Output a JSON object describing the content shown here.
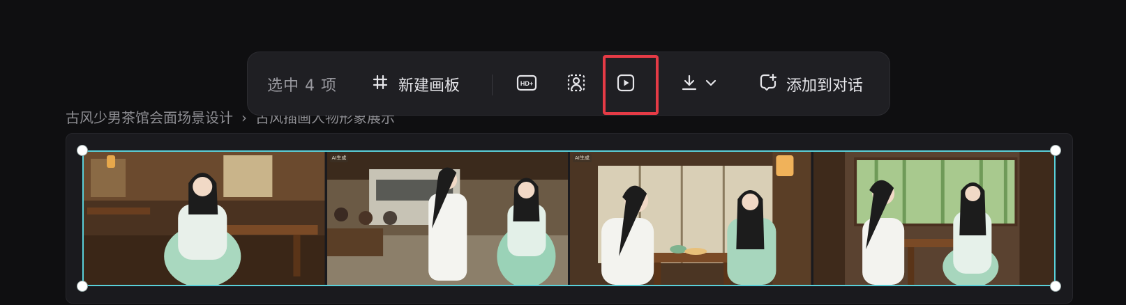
{
  "breadcrumb": {
    "project": "古风少男茶馆会面场景设计",
    "page": "古风插画人物形象展示"
  },
  "toolbar": {
    "selected_count": "选中 4 项",
    "new_board_label": "新建画板",
    "add_to_chat_label": "添加到对话",
    "icons": [
      "crop-frame-icon",
      "hd-upscale-icon",
      "person-cutout-icon",
      "play-video-icon",
      "download-icon",
      "chevron-down-icon",
      "add-chat-icon"
    ],
    "highlight_color": "#e53b46"
  },
  "canvas": {
    "selection_color": "#5ad0d9",
    "frames": [
      {
        "scene": "teahouse-interior-girl-seated",
        "badge": ""
      },
      {
        "scene": "street-courtyard-boy-girl-walking",
        "badge": "AI生成"
      },
      {
        "scene": "folding-screen-tea-table-meeting",
        "badge": "AI生成"
      },
      {
        "scene": "bamboo-window-tea-conversation",
        "badge": ""
      }
    ]
  }
}
